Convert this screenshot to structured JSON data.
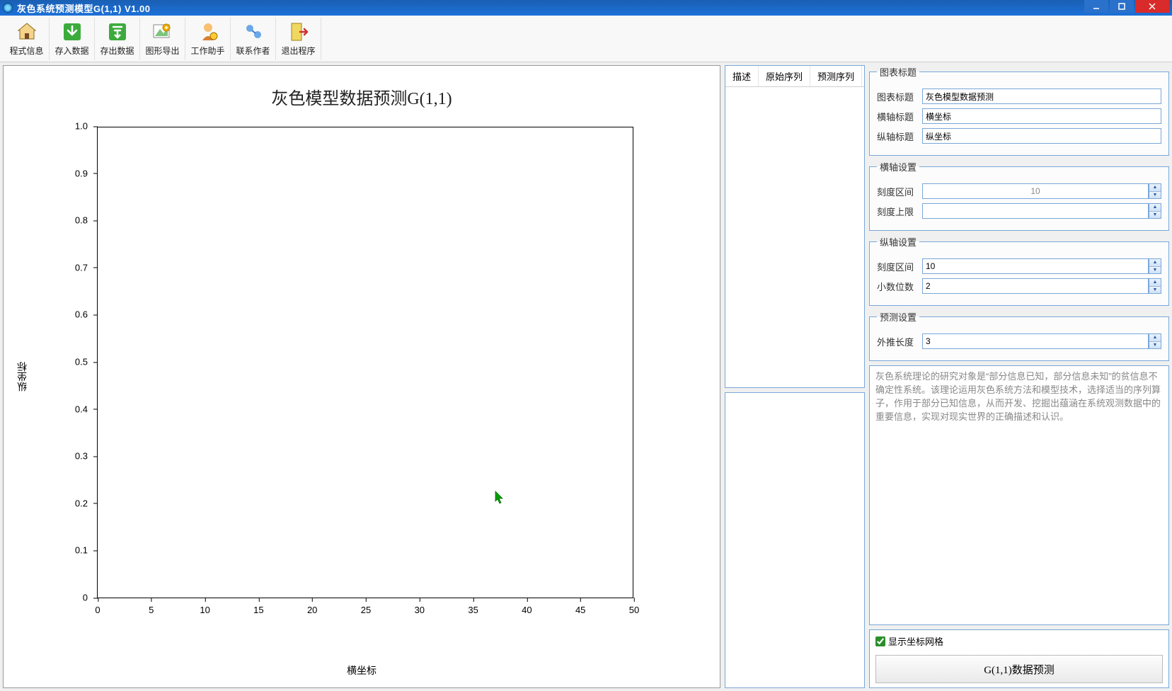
{
  "window": {
    "title": "灰色系统预测模型G(1,1) V1.00"
  },
  "toolbar": {
    "items": [
      {
        "label": "程式信息"
      },
      {
        "label": "存入数据"
      },
      {
        "label": "存出数据"
      },
      {
        "label": "图形导出"
      },
      {
        "label": "工作助手"
      },
      {
        "label": "联系作者"
      },
      {
        "label": "退出程序"
      }
    ]
  },
  "tabs": {
    "t0": "描述",
    "t1": "原始序列",
    "t2": "预测序列"
  },
  "group_chart_title": {
    "legend": "图表标题",
    "l_title": "图表标题",
    "v_title": "灰色模型数据预测",
    "l_xaxis": "横轴标题",
    "v_xaxis": "横坐标",
    "l_yaxis": "纵轴标题",
    "v_yaxis": "纵坐标"
  },
  "group_xaxis": {
    "legend": "横轴设置",
    "l_interval": "刻度区间",
    "v_interval": "10",
    "l_upper": "刻度上限",
    "v_upper": ""
  },
  "group_yaxis": {
    "legend": "纵轴设置",
    "l_interval": "刻度区间",
    "v_interval": "10",
    "l_decimals": "小数位数",
    "v_decimals": "2"
  },
  "group_predict": {
    "legend": "预测设置",
    "l_extrap": "外推长度",
    "v_extrap": "3"
  },
  "description": "灰色系统理论的研究对象是“部分信息已知，部分信息未知”的贫信息不确定性系统。该理论运用灰色系统方法和模型技术，选择适当的序列算子，作用于部分已知信息，从而开发、挖掘出蕴涵在系统观测数据中的重要信息，实现对现实世界的正确描述和认识。",
  "checkbox_grid": "显示坐标网格",
  "run_button": "G(1,1)数据预测",
  "chart_data": {
    "type": "line",
    "title": "灰色模型数据预测G(1,1)",
    "xlabel": "横坐标",
    "ylabel": "纵坐标",
    "xlim": [
      0,
      50
    ],
    "ylim": [
      0,
      1.0
    ],
    "x_ticks": [
      0,
      5,
      10,
      15,
      20,
      25,
      30,
      35,
      40,
      45,
      50
    ],
    "y_ticks": [
      0,
      0.1,
      0.2,
      0.3,
      0.4,
      0.5,
      0.6,
      0.7,
      0.8,
      0.9,
      1.0
    ],
    "series": []
  }
}
